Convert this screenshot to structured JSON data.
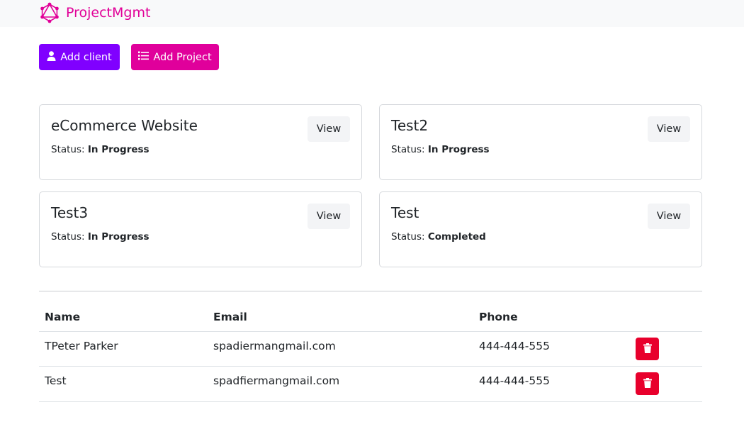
{
  "brand": {
    "name": "ProjectMgmt",
    "icon": "graphql-logo-icon",
    "color": "#e10098"
  },
  "toolbar": {
    "add_client_label": "Add client",
    "add_client_icon": "user-icon",
    "add_project_label": "Add Project",
    "add_project_icon": "list-icon"
  },
  "projects": [
    {
      "name": "eCommerce Website",
      "status_label": "Status:",
      "status": "In Progress",
      "view_label": "View"
    },
    {
      "name": "Test2",
      "status_label": "Status:",
      "status": "In Progress",
      "view_label": "View"
    },
    {
      "name": "Test3",
      "status_label": "Status:",
      "status": "In Progress",
      "view_label": "View"
    },
    {
      "name": "Test",
      "status_label": "Status:",
      "status": "Completed",
      "view_label": "View"
    }
  ],
  "clients_table": {
    "headers": {
      "name": "Name",
      "email": "Email",
      "phone": "Phone"
    },
    "rows": [
      {
        "name": "TPeter Parker",
        "email": "spadiermangmail.com",
        "phone": "444-444-555",
        "action_icon": "trash-icon"
      },
      {
        "name": "Test",
        "email": "spadfiermangmail.com",
        "phone": "444-444-555",
        "action_icon": "trash-icon"
      }
    ]
  },
  "colors": {
    "add_client": "#8000ff",
    "add_project": "#e0009b",
    "delete": "#e8002c"
  }
}
